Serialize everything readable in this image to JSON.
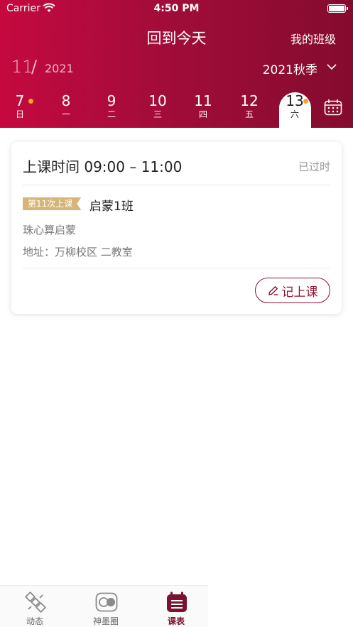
{
  "status_bar": {
    "carrier": "Carrier",
    "time": "4:50 PM"
  },
  "nav": {
    "title": "回到今天",
    "right_button": "我的班级"
  },
  "date_header": {
    "month": "11",
    "slash": "/",
    "year": "2021",
    "season": "2021秋季"
  },
  "days": [
    {
      "num": "7",
      "weekday": "日",
      "has_dot": true,
      "selected": false
    },
    {
      "num": "8",
      "weekday": "一",
      "has_dot": false,
      "selected": false
    },
    {
      "num": "9",
      "weekday": "二",
      "has_dot": false,
      "selected": false
    },
    {
      "num": "10",
      "weekday": "三",
      "has_dot": false,
      "selected": false
    },
    {
      "num": "11",
      "weekday": "四",
      "has_dot": false,
      "selected": false
    },
    {
      "num": "12",
      "weekday": "五",
      "has_dot": false,
      "selected": false
    },
    {
      "num": "13",
      "weekday": "六",
      "has_dot": true,
      "selected": true
    }
  ],
  "lesson_card": {
    "time": "上课时间 09:00 – 11:00",
    "status": "已过时",
    "badge": "第11次上课",
    "class_name": "启蒙1班",
    "course": "珠心算启蒙",
    "address": "地址：万柳校区 二教室",
    "record_button": "记上课"
  },
  "tabbar": [
    {
      "label": "动态",
      "icon": "satellite-icon",
      "active": false
    },
    {
      "label": "神墨圈",
      "icon": "toggle-circle-icon",
      "active": false
    },
    {
      "label": "课表",
      "icon": "calendar-list-icon",
      "active": true
    }
  ],
  "colors": {
    "header_start": "#c5093f",
    "header_end": "#840b2e",
    "accent": "#8f1232",
    "badge": "#d7b477",
    "dot": "#f3a623"
  }
}
